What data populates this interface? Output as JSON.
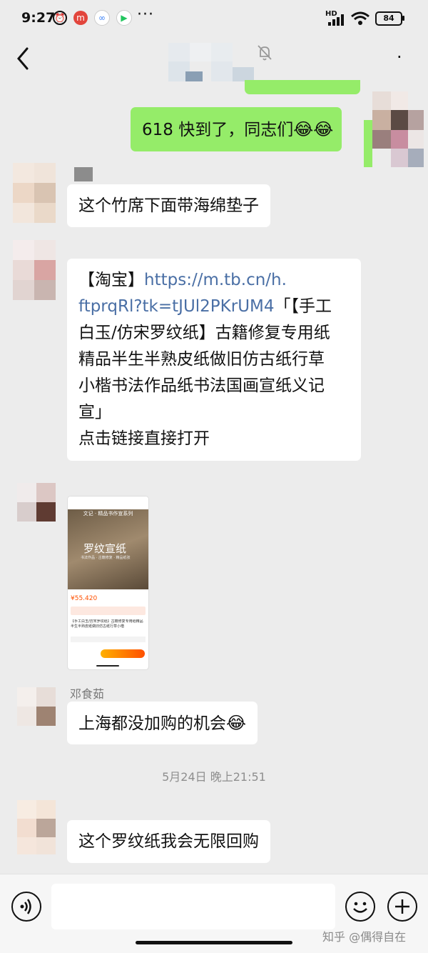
{
  "status_bar": {
    "time": "9:27",
    "hd": "HD",
    "battery": "84",
    "more": "···"
  },
  "nav": {
    "menu_glyph": "·"
  },
  "messages": {
    "m1_text": "618 快到了，同志们",
    "m2_text": "这个竹席下面带海绵垫子",
    "m3": {
      "lines": [
        {
          "prefix": "【淘宝】",
          "link": "https://m.tb.cn/h.",
          "suffix": ""
        },
        {
          "prefix": "",
          "link": "ftprqRl?tk=tJUl2PKrUM4",
          "suffix": "「【手工"
        },
        {
          "prefix": "白玉/仿宋罗纹纸】古籍修复专用纸",
          "link": "",
          "suffix": ""
        },
        {
          "prefix": "精品半生半熟皮纸做旧仿古纸行草",
          "link": "",
          "suffix": ""
        },
        {
          "prefix": "小楷书法作品纸书法国画宣纸义记",
          "link": "",
          "suffix": ""
        },
        {
          "prefix": "宣」",
          "link": "",
          "suffix": ""
        },
        {
          "prefix": "点击链接直接打开",
          "link": "",
          "suffix": ""
        }
      ]
    },
    "m4_image": {
      "banner_top": "文记 · 精品书作宣系列",
      "title": "罗纹宣纸",
      "subtitle": "书法作品 · 古籍修复 · 精品纸张",
      "price": "¥55.420",
      "product_text": "【手工白玉/仿宋罗纹纸】古籍修复专用纸精品半生半熟皮纸做旧仿古纸行草小楷"
    },
    "m5_sender": "邓食茹",
    "m5_text": "上海都没加购的机会",
    "timestamp": "5月24日 晚上21:51",
    "m6_text": "这个罗纹纸我会无限回购"
  },
  "input_bar": {
    "placeholder": ""
  },
  "watermark": "知乎 @偶得自在",
  "colors": {
    "green_bubble": "#95ec69",
    "link": "#4a6fa5",
    "background": "#ececec"
  }
}
